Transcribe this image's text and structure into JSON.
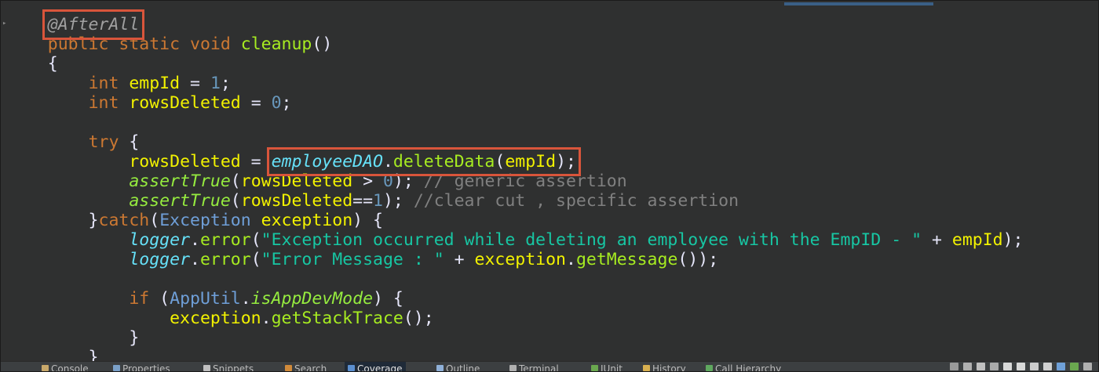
{
  "editor": {
    "lines": [
      [
        {
          "t": "    ",
          "c": "pun"
        },
        {
          "t": "@AfterAll",
          "c": "ann",
          "box": true
        }
      ],
      [
        {
          "t": "    ",
          "c": "pun"
        },
        {
          "t": "public",
          "c": "kw"
        },
        {
          "t": " ",
          "c": "pun"
        },
        {
          "t": "static",
          "c": "kw"
        },
        {
          "t": " ",
          "c": "pun"
        },
        {
          "t": "void",
          "c": "kw"
        },
        {
          "t": " ",
          "c": "pun"
        },
        {
          "t": "cleanup",
          "c": "mth"
        },
        {
          "t": "()",
          "c": "pun"
        }
      ],
      [
        {
          "t": "    {",
          "c": "pun"
        }
      ],
      [
        {
          "t": "        ",
          "c": "pun"
        },
        {
          "t": "int",
          "c": "kw"
        },
        {
          "t": " ",
          "c": "pun"
        },
        {
          "t": "empId",
          "c": "var"
        },
        {
          "t": " = ",
          "c": "pun"
        },
        {
          "t": "1",
          "c": "num"
        },
        {
          "t": ";",
          "c": "pun"
        }
      ],
      [
        {
          "t": "        ",
          "c": "pun"
        },
        {
          "t": "int",
          "c": "kw"
        },
        {
          "t": " ",
          "c": "pun"
        },
        {
          "t": "rowsDeleted",
          "c": "var"
        },
        {
          "t": " = ",
          "c": "pun"
        },
        {
          "t": "0",
          "c": "num"
        },
        {
          "t": ";",
          "c": "pun"
        }
      ],
      [
        {
          "t": "",
          "c": "pun"
        }
      ],
      [
        {
          "t": "        ",
          "c": "pun"
        },
        {
          "t": "try",
          "c": "kw"
        },
        {
          "t": " {",
          "c": "pun"
        }
      ],
      [
        {
          "t": "            ",
          "c": "pun"
        },
        {
          "t": "rowsDeleted",
          "c": "var"
        },
        {
          "t": " = ",
          "c": "pun"
        },
        {
          "t": "employeeDAO.deleteData(empId);",
          "c": "group",
          "box": true,
          "parts": [
            {
              "t": "employeeDAO",
              "c": "fld"
            },
            {
              "t": ".",
              "c": "pun"
            },
            {
              "t": "deleteData",
              "c": "mth"
            },
            {
              "t": "(",
              "c": "pun"
            },
            {
              "t": "empId",
              "c": "var"
            },
            {
              "t": ");",
              "c": "pun"
            }
          ]
        }
      ],
      [
        {
          "t": "            ",
          "c": "pun"
        },
        {
          "t": "assertTrue",
          "c": "smc"
        },
        {
          "t": "(",
          "c": "pun"
        },
        {
          "t": "rowsDeleted",
          "c": "var"
        },
        {
          "t": " > ",
          "c": "pun"
        },
        {
          "t": "0",
          "c": "num"
        },
        {
          "t": "); ",
          "c": "pun"
        },
        {
          "t": "// generic assertion",
          "c": "cmt"
        }
      ],
      [
        {
          "t": "            ",
          "c": "pun"
        },
        {
          "t": "assertTrue",
          "c": "smc"
        },
        {
          "t": "(",
          "c": "pun"
        },
        {
          "t": "rowsDeleted",
          "c": "var"
        },
        {
          "t": "==",
          "c": "pun"
        },
        {
          "t": "1",
          "c": "num"
        },
        {
          "t": "); ",
          "c": "pun"
        },
        {
          "t": "//clear cut , specific assertion",
          "c": "cmt"
        }
      ],
      [
        {
          "t": "        }",
          "c": "pun"
        },
        {
          "t": "catch",
          "c": "kw"
        },
        {
          "t": "(",
          "c": "pun"
        },
        {
          "t": "Exception",
          "c": "typ"
        },
        {
          "t": " ",
          "c": "pun"
        },
        {
          "t": "exception",
          "c": "var"
        },
        {
          "t": ") {",
          "c": "pun"
        }
      ],
      [
        {
          "t": "            ",
          "c": "pun"
        },
        {
          "t": "logger",
          "c": "fld"
        },
        {
          "t": ".",
          "c": "pun"
        },
        {
          "t": "error",
          "c": "mth"
        },
        {
          "t": "(",
          "c": "pun"
        },
        {
          "t": "\"Exception occurred while deleting an employee with the EmpID - \"",
          "c": "str"
        },
        {
          "t": " + ",
          "c": "pun"
        },
        {
          "t": "empId",
          "c": "var"
        },
        {
          "t": ");",
          "c": "pun"
        }
      ],
      [
        {
          "t": "            ",
          "c": "pun"
        },
        {
          "t": "logger",
          "c": "fld"
        },
        {
          "t": ".",
          "c": "pun"
        },
        {
          "t": "error",
          "c": "mth"
        },
        {
          "t": "(",
          "c": "pun"
        },
        {
          "t": "\"Error Message : \"",
          "c": "str"
        },
        {
          "t": " + ",
          "c": "pun"
        },
        {
          "t": "exception",
          "c": "var"
        },
        {
          "t": ".",
          "c": "pun"
        },
        {
          "t": "getMessage",
          "c": "mth"
        },
        {
          "t": "());",
          "c": "pun"
        }
      ],
      [
        {
          "t": "",
          "c": "pun"
        }
      ],
      [
        {
          "t": "            ",
          "c": "pun"
        },
        {
          "t": "if",
          "c": "kw"
        },
        {
          "t": " (",
          "c": "pun"
        },
        {
          "t": "AppUtil",
          "c": "typ"
        },
        {
          "t": ".",
          "c": "pun"
        },
        {
          "t": "isAppDevMode",
          "c": "smc"
        },
        {
          "t": ") {",
          "c": "pun"
        }
      ],
      [
        {
          "t": "                ",
          "c": "pun"
        },
        {
          "t": "exception",
          "c": "var"
        },
        {
          "t": ".",
          "c": "pun"
        },
        {
          "t": "getStackTrace",
          "c": "mth"
        },
        {
          "t": "();",
          "c": "pun"
        }
      ],
      [
        {
          "t": "            }",
          "c": "pun"
        }
      ],
      [
        {
          "t": "        }",
          "c": "pun"
        }
      ]
    ]
  },
  "bottom_tabs": [
    {
      "label": "Console",
      "icon": "console-icon",
      "color": "#c8a86a"
    },
    {
      "label": "Properties",
      "icon": "properties-icon",
      "color": "#7aa0c8"
    },
    {
      "label": "Snippets",
      "icon": "snippets-icon",
      "color": "#c0c0c0"
    },
    {
      "label": "Search",
      "icon": "search-icon",
      "color": "#d08a3a"
    },
    {
      "label": "Coverage",
      "icon": "coverage-icon",
      "color": "#5b8fd0",
      "active": true
    },
    {
      "label": "Outline",
      "icon": "outline-icon",
      "color": "#8fb0d8"
    },
    {
      "label": "Terminal",
      "icon": "terminal-icon",
      "color": "#b0b0b0"
    },
    {
      "label": "JUnit",
      "icon": "junit-icon",
      "color": "#6aa84f"
    },
    {
      "label": "History",
      "icon": "history-icon",
      "color": "#d8b050"
    },
    {
      "label": "Call Hierarchy",
      "icon": "call-hierarchy-icon",
      "color": "#5fa85f"
    }
  ],
  "toolbar_icons": [
    "remove-launch-icon",
    "remove-all-icon",
    "collapse-icon",
    "merge-icon",
    "scroll-lock-icon",
    "word-wrap-icon",
    "pin-icon",
    "display-selected-icon",
    "new-console-icon",
    "minimize-icon",
    "maximize-icon"
  ]
}
